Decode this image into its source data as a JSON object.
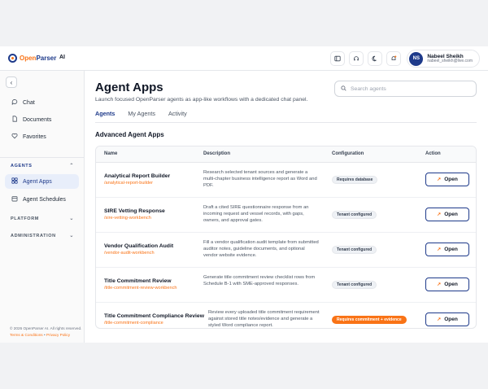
{
  "brand": {
    "open": "Open",
    "parser": "Parser",
    "ai": "AI"
  },
  "header": {
    "icons": [
      "panel-icon",
      "headset-icon",
      "moon-icon",
      "notification-icon"
    ],
    "user": {
      "initials": "NS",
      "name": "Nabeel Sheikh",
      "email": "nabeel_sheikh@live.com"
    }
  },
  "sidebar": {
    "top_items": [
      {
        "label": "Chat",
        "icon": "chat-icon"
      },
      {
        "label": "Documents",
        "icon": "document-icon"
      },
      {
        "label": "Favorites",
        "icon": "heart-icon"
      }
    ],
    "agents_label": "AGENTS",
    "agent_items": [
      {
        "label": "Agent Apps",
        "icon": "apps-icon",
        "active": true
      },
      {
        "label": "Agent Schedules",
        "icon": "calendar-icon"
      }
    ],
    "platform_label": "PLATFORM",
    "administration_label": "ADMINISTRATION",
    "copyright": "© 2026 OpenParser AI. All rights reserved.",
    "terms": "Terms & Conditions",
    "separator": "•",
    "privacy": "Privacy Policy"
  },
  "main": {
    "title": "Agent Apps",
    "subtitle": "Launch focused OpenParser agents as app-like workflows with a dedicated chat panel.",
    "search_placeholder": "Search agents",
    "tabs": [
      {
        "label": "Agents",
        "active": true
      },
      {
        "label": "My Agents"
      },
      {
        "label": "Activity"
      }
    ],
    "section_title": "Advanced Agent Apps",
    "columns": [
      "Name",
      "Description",
      "Configuration",
      "Action"
    ],
    "open_label": "Open",
    "rows": [
      {
        "name": "Analytical Report Builder",
        "path": "/analytical-report-builder",
        "description": "Research selected tenant sources and generate a multi-chapter business intelligence report as Word and PDF.",
        "config": "Requires database",
        "config_type": "neutral"
      },
      {
        "name": "SIRE Vetting Response",
        "path": "/sire-vetting-workbench",
        "description": "Draft a cited SIRE questionnaire response from an incoming request and vessel records, with gaps, owners, and approval gates.",
        "config": "Tenant configured",
        "config_type": "neutral"
      },
      {
        "name": "Vendor Qualification Audit",
        "path": "/vendor-audit-workbench",
        "description": "Fill a vendor qualification audit template from submitted auditor notes, guideline documents, and optional vendor website evidence.",
        "config": "Tenant configured",
        "config_type": "neutral"
      },
      {
        "name": "Title Commitment Review",
        "path": "/title-commitment-review-workbench",
        "description": "Generate title commitment review checklist rows from Schedule B-1 with SME-approved responses.",
        "config": "Tenant configured",
        "config_type": "neutral"
      },
      {
        "name": "Title Commitment Compliance Review",
        "path": "/title-commitment-compliance",
        "description": "Review every uploaded title commitment requirement against stored title notes/evidence and generate a styled Word compliance report.",
        "config": "Requires commitment + evidence",
        "config_type": "warn"
      }
    ]
  },
  "colors": {
    "brand_navy": "#1e3a8a",
    "brand_orange": "#f97316"
  }
}
